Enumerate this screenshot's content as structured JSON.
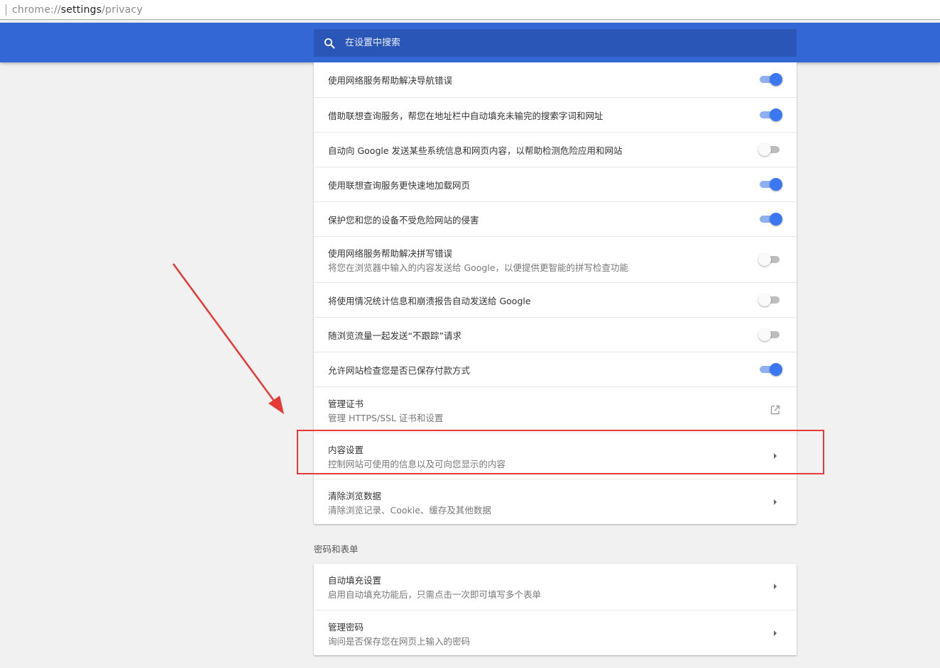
{
  "address_bar": {
    "scheme": "chrome://",
    "host": "settings",
    "path": "/privacy"
  },
  "search": {
    "placeholder": "在设置中搜索"
  },
  "privacy_rows": [
    {
      "label": "使用网络服务帮助解决导航错误",
      "control": "toggle",
      "checked": true
    },
    {
      "label": "借助联想查询服务，帮您在地址栏中自动填充未输完的搜索字词和网址",
      "control": "toggle",
      "checked": true
    },
    {
      "label": "自动向 Google 发送某些系统信息和网页内容，以帮助检测危险应用和网站",
      "control": "toggle",
      "checked": false
    },
    {
      "label": "使用联想查询服务更快速地加载网页",
      "control": "toggle",
      "checked": true
    },
    {
      "label": "保护您和您的设备不受危险网站的侵害",
      "control": "toggle",
      "checked": true
    },
    {
      "label": "使用网络服务帮助解决拼写错误",
      "sublabel": "将您在浏览器中输入的内容发送给 Google，以便提供更智能的拼写检查功能",
      "control": "toggle",
      "checked": false
    },
    {
      "label": "将使用情况统计信息和崩溃报告自动发送给 Google",
      "control": "toggle",
      "checked": false
    },
    {
      "label": "随浏览流量一起发送“不跟踪”请求",
      "control": "toggle",
      "checked": false
    },
    {
      "label": "允许网站检查您是否已保存付款方式",
      "control": "toggle",
      "checked": true
    },
    {
      "label": "管理证书",
      "sublabel": "管理 HTTPS/SSL 证书和设置",
      "control": "external-link-icon"
    },
    {
      "label": "内容设置",
      "sublabel": "控制网站可使用的信息以及可向您显示的内容",
      "control": "chevron-right-icon"
    },
    {
      "label": "清除浏览数据",
      "sublabel": "清除浏览记录、Cookie、缓存及其他数据",
      "control": "chevron-right-icon"
    }
  ],
  "passwords_section": {
    "title": "密码和表单",
    "rows": [
      {
        "label": "自动填充设置",
        "sublabel": "启用自动填充功能后，只需点击一次即可填写多个表单",
        "control": "chevron-right-icon"
      },
      {
        "label": "管理密码",
        "sublabel": "询问是否保存您在网页上输入的密码",
        "control": "chevron-right-icon"
      }
    ]
  },
  "annotation": {
    "highlight_color": "#e53935",
    "highlighted_item": "内容设置"
  },
  "colors": {
    "header": "#3367d6",
    "search_bg": "#2a56b8",
    "toggle_on": "#3a77f0",
    "page_bg": "#f1f1f1"
  }
}
